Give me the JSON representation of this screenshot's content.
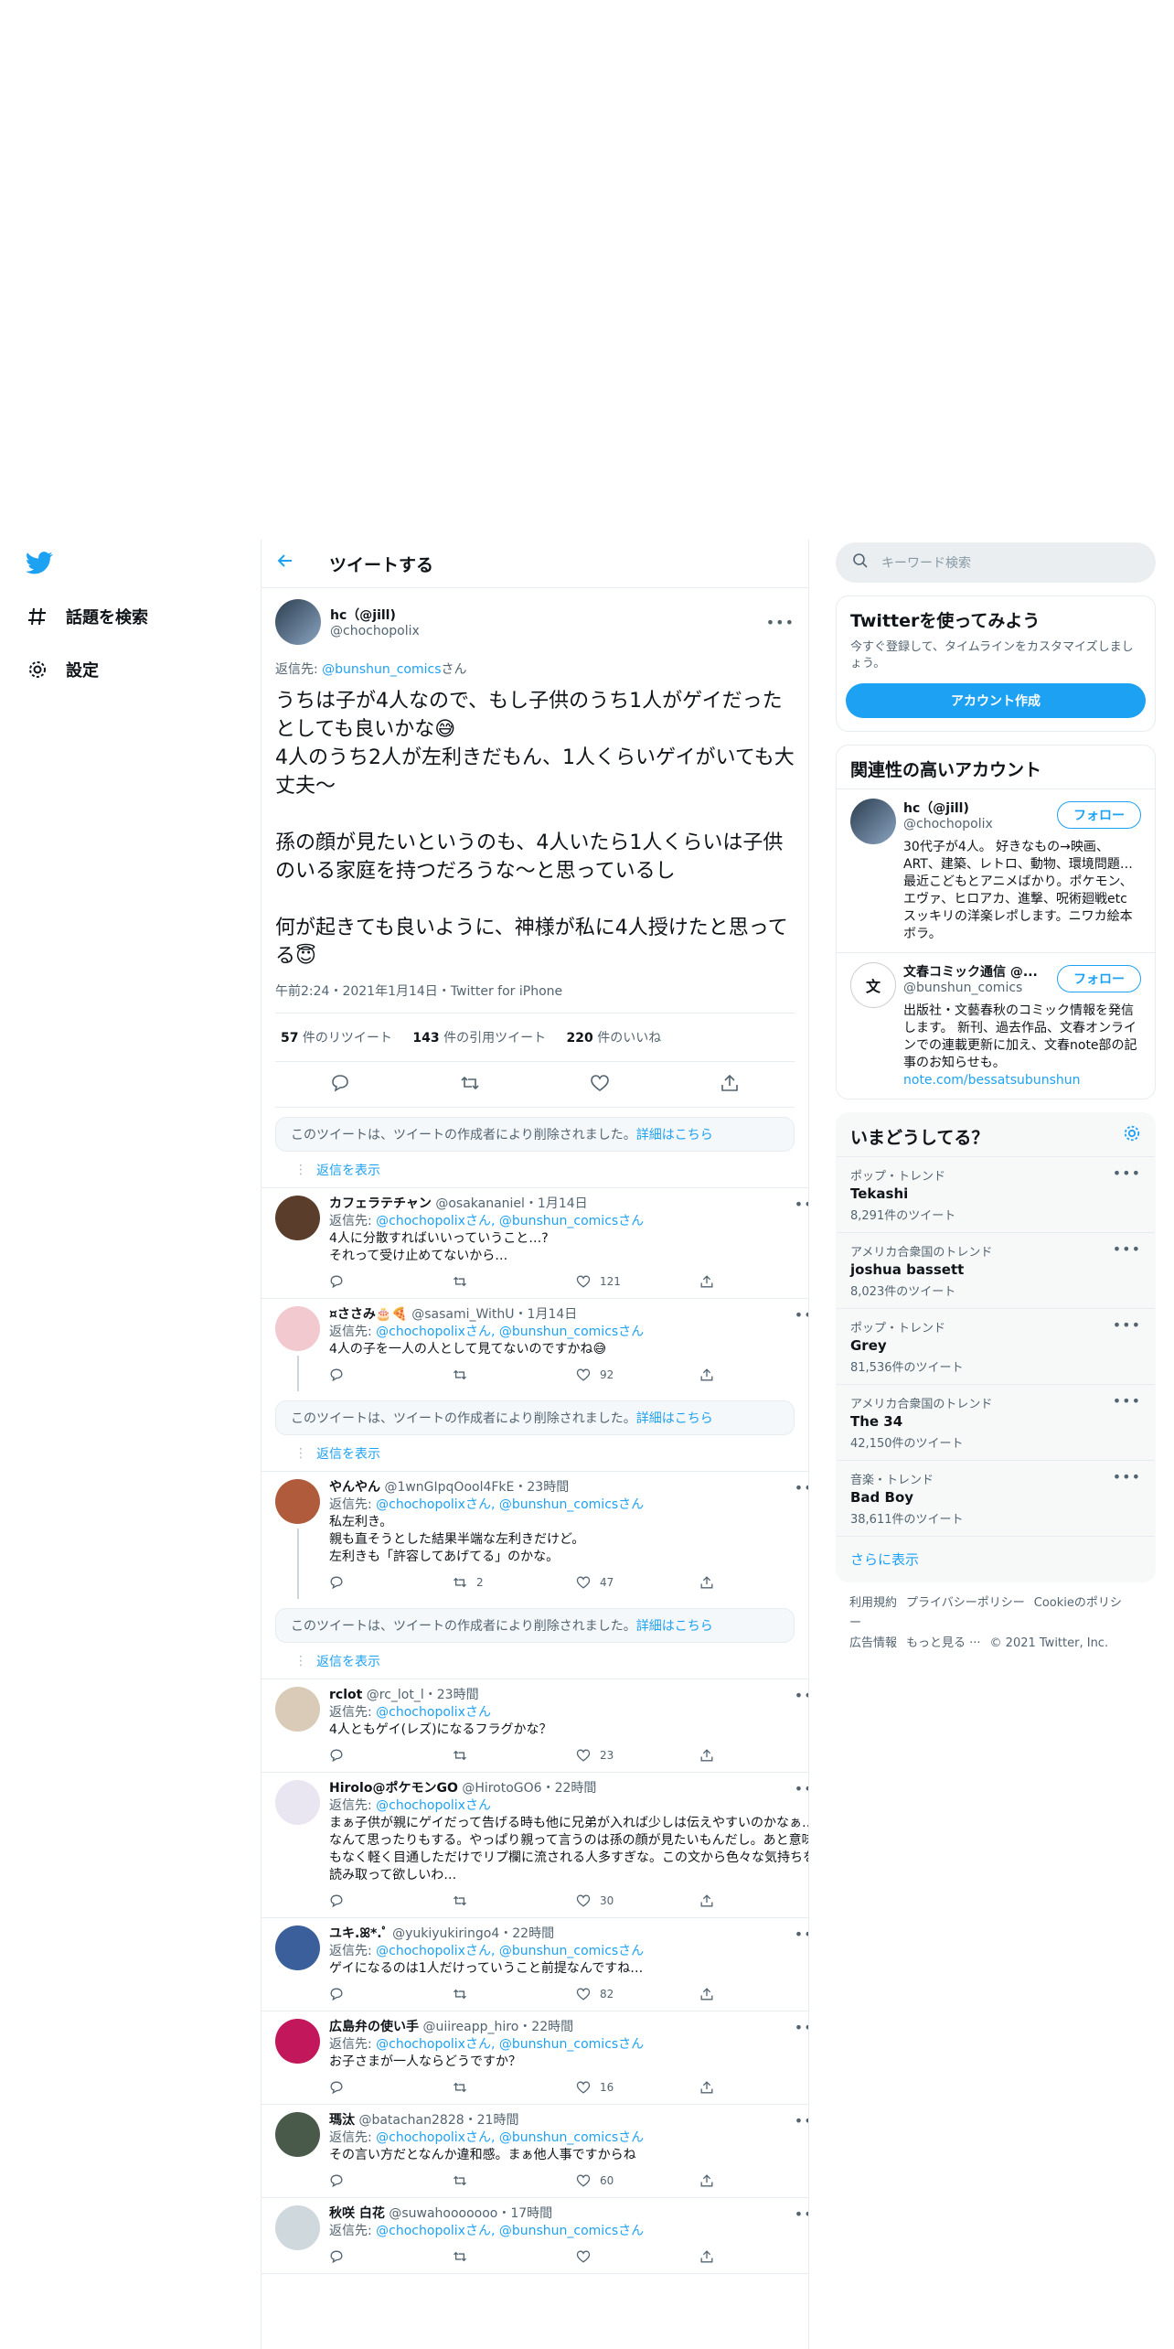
{
  "nav": {
    "explore_label": "話題を検索",
    "settings_label": "設定"
  },
  "header": {
    "title": "ツイートする"
  },
  "main_tweet": {
    "name": "hc（@jill)",
    "handle": "@chochopolix",
    "reply_prefix": "返信先: ",
    "reply_to": "@bunshun_comics",
    "reply_suffix": "さん",
    "text": "うちは子が4人なので、もし子供のうち1人がゲイだったとしても良いかな😅\n4人のうち2人が左利きだもん、1人くらいゲイがいても大丈夫〜\n\n孫の顔が見たいというのも、4人いたら1人くらいは子供のいる家庭を持つだろうな〜と思っているし\n\n何が起きても良いように、神様が私に4人授けたと思ってる😇",
    "meta": "午前2:24・2021年1月14日・Twitter for iPhone",
    "retweets": "57",
    "retweets_label": " 件のリツイート",
    "quotes": "143",
    "quotes_label": " 件の引用ツイート",
    "likes": "220",
    "likes_label": " 件のいいね"
  },
  "deleted_notice": {
    "text": "このツイートは、ツイートの作成者により削除されました。",
    "link": "詳細はこちら"
  },
  "show_replies": "返信を表示",
  "replies": [
    {
      "name": "カフェラテチャン",
      "handle": "@osakananiel",
      "time": "・1月14日",
      "reply_to": "@chochopolixさん, @bunshun_comicsさん",
      "text": "4人に分散すればいいっていうこと…?\nそれって受け止めてないから…",
      "retweets": "",
      "likes": "121"
    },
    {
      "name": "¤ささみ🎂🍕",
      "handle": "@sasami_WithU",
      "time": "・1月14日",
      "reply_to": "@chochopolixさん, @bunshun_comicsさん",
      "text": "4人の子を一人の人として見てないのですかね😅",
      "retweets": "",
      "likes": "92"
    },
    {
      "name": "やんやん",
      "handle": "@1wnGIpqOool4FkE",
      "time": "・23時間",
      "reply_to": "@chochopolixさん, @bunshun_comicsさん",
      "text": "私左利き。\n親も直そうとした結果半端な左利きだけど。\n左利きも「許容してあげてる」のかな。",
      "retweets": "2",
      "likes": "47"
    },
    {
      "name": "rclot",
      "handle": "@rc_lot_l",
      "time": "・23時間",
      "reply_to": "@chochopolixさん",
      "text": "4人ともゲイ(レズ)になるフラグかな？",
      "retweets": "",
      "likes": "23"
    },
    {
      "name": "Hirolo@ポケモンGO",
      "handle": "@HirotoGO6",
      "time": "・22時間",
      "reply_to": "@chochopolixさん",
      "text": "まぁ子供が親にゲイだって告げる時も他に兄弟が入れば少しは伝えやすいのかなぁ…なんて思ったりもする。やっぱり親って言うのは孫の顔が見たいもんだし。あと意味もなく軽く目通しただけでリプ欄に流される人多すぎな。この文から色々な気持ちを読み取って欲しいわ…",
      "retweets": "",
      "likes": "30"
    },
    {
      "name": "ユキ.ꕤ*.ﾟ",
      "handle": "@yukiyukiringo4",
      "time": "・22時間",
      "reply_to": "@chochopolixさん, @bunshun_comicsさん",
      "text": "ゲイになるのは1人だけっていうこと前提なんですね…",
      "retweets": "",
      "likes": "82"
    },
    {
      "name": "広島弁の使い手",
      "handle": "@uiireapp_hiro",
      "time": "・22時間",
      "reply_to": "@chochopolixさん, @bunshun_comicsさん",
      "text": "お子さまが一人ならどうですか？",
      "retweets": "",
      "likes": "16"
    },
    {
      "name": "瑪汰",
      "handle": "@batachan2828",
      "time": "・21時間",
      "reply_to": "@chochopolixさん, @bunshun_comicsさん",
      "text": "その言い方だとなんか違和感。まぁ他人事ですからね",
      "retweets": "",
      "likes": "60"
    },
    {
      "name": "秋咲 白花",
      "handle": "@suwahooooooo",
      "time": "・17時間",
      "reply_to": "@chochopolixさん, @bunshun_comicsさん",
      "text": "",
      "retweets": "",
      "likes": ""
    }
  ],
  "right": {
    "search_placeholder": "キーワード検索",
    "signup": {
      "title": "Twitterを使ってみよう",
      "subtitle": "今すぐ登録して、タイムラインをカスタマイズしましょう。",
      "button": "アカウント作成"
    },
    "related": {
      "title": "関連性の高いアカウント",
      "follow_label": "フォロー",
      "accounts": [
        {
          "name": "hc（@jill)",
          "handle": "@chochopolix",
          "bio": "30代子が4人。 好きなもの→映画、ART、建築、レトロ、動物、環境問題…最近こどもとアニメばかり。ポケモン、エヴァ、ヒロアカ、進撃、呪術廻戦etc スッキリの洋楽レポします。ニワカ絵本ボラ。"
        },
        {
          "name": "文春コミック通信 @...",
          "handle": "@bunshun_comics",
          "bio": "出版社・文藝春秋のコミック情報を発信します。 新刊、過去作品、文春オンラインでの連載更新に加え、文春note部の記事のお知らせも。",
          "link": "note.com/bessatsubunshun"
        }
      ]
    },
    "trends": {
      "title": "いまどうしてる？",
      "items": [
        {
          "context": "ポップ・トレンド",
          "name": "Tekashi",
          "count": "8,291件のツイート"
        },
        {
          "context": "アメリカ合衆国のトレンド",
          "name": "joshua bassett",
          "count": "8,023件のツイート"
        },
        {
          "context": "ポップ・トレンド",
          "name": "Grey",
          "count": "81,536件のツイート"
        },
        {
          "context": "アメリカ合衆国のトレンド",
          "name": "The 34",
          "count": "42,150件のツイート"
        },
        {
          "context": "音楽・トレンド",
          "name": "Bad Boy",
          "count": "38,611件のツイート"
        }
      ],
      "more": "さらに表示"
    },
    "footer": {
      "terms": "利用規約",
      "privacy": "プライバシーポリシー",
      "cookie": "Cookieのポリシー",
      "ads": "広告情報",
      "more": "もっと見る ···",
      "copyright": "© 2021 Twitter, Inc."
    }
  },
  "colors": {
    "accent": "#1da1f2",
    "text": "#0f1419",
    "secondary": "#536471",
    "border": "#e6ecf0"
  }
}
